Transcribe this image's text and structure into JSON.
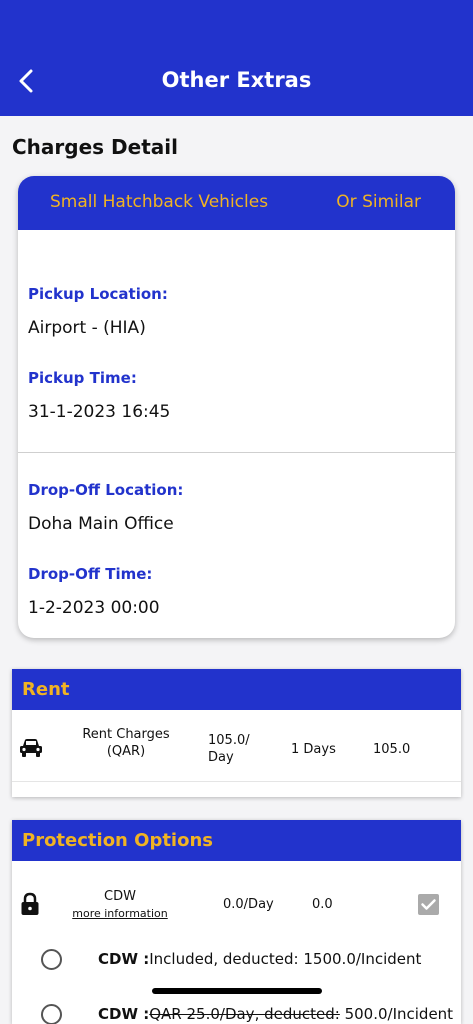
{
  "appbar": {
    "title": "Other Extras",
    "back_icon": "chevron-left-icon"
  },
  "section_title": "Charges Detail",
  "vehicle": {
    "name": "Small Hatchback Vehicles",
    "similar": "Or Similar"
  },
  "pickup": {
    "location_label": "Pickup Location:",
    "location_value": "Airport - (HIA)",
    "time_label": "Pickup Time:",
    "time_value": "31-1-2023  16:45"
  },
  "dropoff": {
    "location_label": "Drop-Off Location:",
    "location_value": "Doha Main Office",
    "time_label": "Drop-Off Time:",
    "time_value": "1-2-2023  00:00"
  },
  "rent": {
    "header": "Rent",
    "label_line1": "Rent Charges",
    "label_line2": "(QAR)",
    "rate_line1": "105.0/",
    "rate_line2": "Day",
    "days": "1 Days",
    "total": "105.0",
    "icon": "car-icon"
  },
  "protection": {
    "header": "Protection Options",
    "icon": "lock-icon",
    "cdw_name": "CDW",
    "more_info": "more information",
    "cdw_rate": "0.0/Day",
    "cdw_total": "0.0",
    "options": [
      {
        "bold": "CDW :",
        "text": "Included, deducted: 1500.0/Incident"
      },
      {
        "bold": "CDW :",
        "text_strike": "QAR 25.0/Day, deducted:",
        "text": " 500.0/Incident"
      }
    ]
  },
  "colors": {
    "primary": "#2233cc",
    "accent": "#f0b323"
  }
}
